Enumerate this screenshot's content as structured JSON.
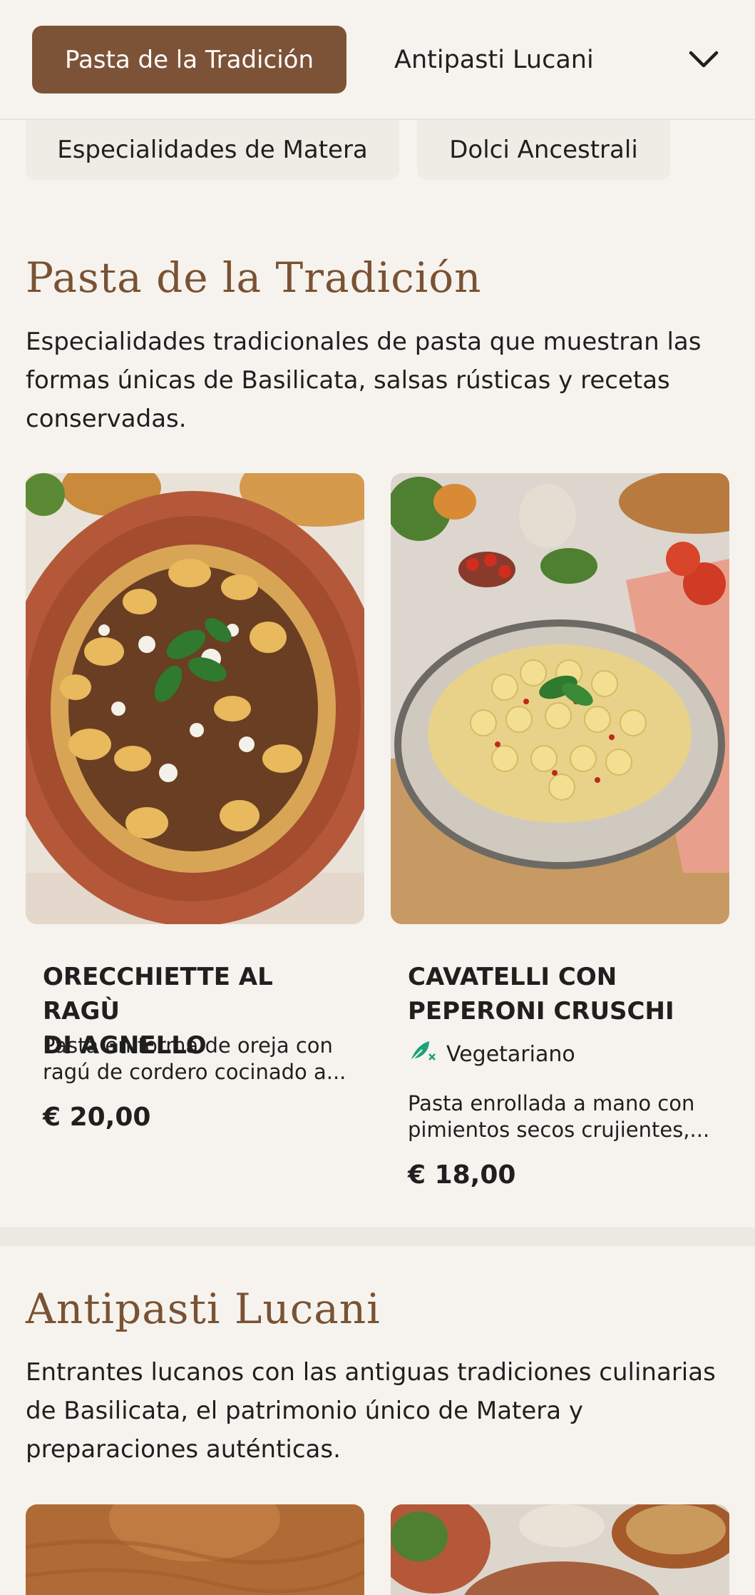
{
  "nav": {
    "active_tab": "Pasta de la Tradición",
    "second_tab": "Antipasti Lucani",
    "pills": [
      "Especialidades de Matera",
      "Dolci Ancestrali"
    ]
  },
  "sections": [
    {
      "title": "Pasta de la Tradición",
      "description": "Especialidades tradicionales de pasta que muestran las formas únicas de Basilicata, salsas rústicas y recetas conservadas.",
      "desc_lines": [
        "Especialidades tradicionales de pasta que muestran las",
        "formas únicas de Basilicata, salsas rústicas y recetas",
        "conservadas."
      ],
      "items": [
        {
          "name_lines": [
            "ORECCHIETTE AL RAGÙ",
            "DI AGNELLO"
          ],
          "desc_lines": [
            "Pasta en forma de oreja con",
            "ragú de cordero cocinado a..."
          ],
          "price": "€ 20,00"
        },
        {
          "name_lines": [
            "CAVATELLI CON",
            "PEPERONI CRUSCHI"
          ],
          "badge": "Vegetariano",
          "desc_lines": [
            "Pasta enrollada a mano con",
            "pimientos secos crujientes,..."
          ],
          "price": "€ 18,00"
        }
      ]
    },
    {
      "title": "Antipasti Lucani",
      "desc_lines": [
        "Entrantes lucanos con las antiguas tradiciones culinarias",
        "de Basilicata, el patrimonio único de Matera y",
        "preparaciones auténticas."
      ]
    }
  ],
  "colors": {
    "accent": "#7d5338",
    "title": "#7a5233",
    "background": "#f6f3ee",
    "veg_icon": "#1aa37a"
  },
  "icons": {
    "dropdown": "chevron-down-icon",
    "vegetarian": "leaf-icon"
  }
}
